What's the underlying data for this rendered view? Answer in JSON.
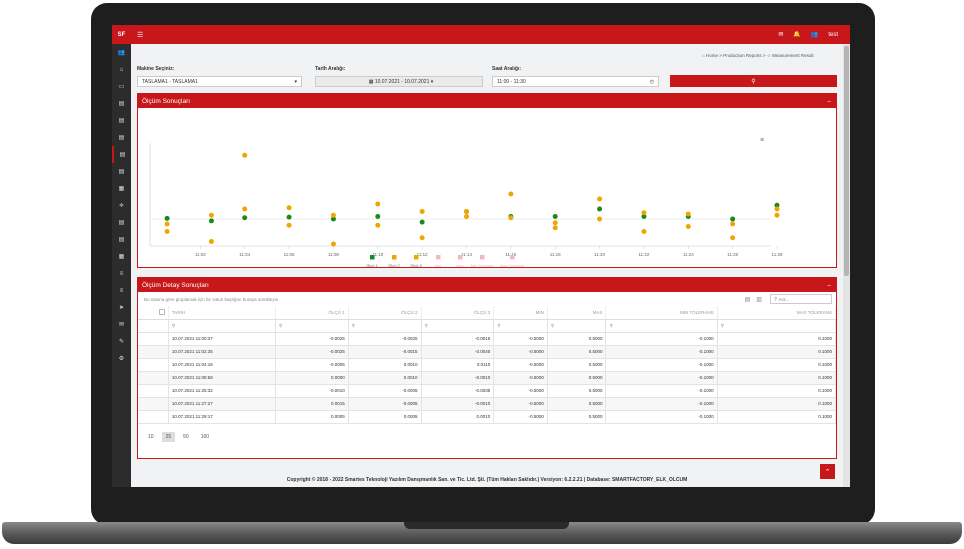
{
  "app": {
    "logo": "SF",
    "menu_icon": "hamburger-icon",
    "topbar_icons": [
      "chat-icon",
      "bell-icon",
      "users-icon"
    ],
    "username": "test"
  },
  "sidebar": {
    "icons": [
      "users-icon",
      "home-icon",
      "monitor-icon",
      "file-icon",
      "file-icon",
      "file-icon",
      "file-icon",
      "file-icon",
      "calendar-icon",
      "settings-icon",
      "file-icon",
      "file-icon",
      "calendar-icon",
      "list-icon",
      "list-icon",
      "send-icon",
      "chat-icon",
      "pen-icon",
      "gear-icon"
    ]
  },
  "breadcrumb": {
    "home": "Home",
    "reports": "Production Reports",
    "current": "Measurement Result"
  },
  "filters": {
    "machine_label": "Makine Seçiniz:",
    "machine_value": "TASLAMA1 - TASLAMA1",
    "date_label": "Tarih Aralığı:",
    "date_value": "10.07.2021 - 10.07.2021",
    "time_label": "Saat Aralığı:",
    "time_value": "11:00 - 11:30",
    "search_icon": "search-icon"
  },
  "chart_panel": {
    "title": "Ölçüm Sonuçları",
    "collapse": "–",
    "menu_icon": "menu-icon"
  },
  "chart_data": {
    "type": "scatter",
    "x_ticks": [
      "11:02",
      "11:04",
      "11:06",
      "11:08",
      "11:10",
      "11:12",
      "11:14",
      "11:16",
      "11:18",
      "11:20",
      "11:22",
      "11:24",
      "11:26",
      "11:28"
    ],
    "series": [
      {
        "name": "Ölçü 1",
        "color": "#1a8a1a",
        "points": [
          [
            0.5,
            0.05
          ],
          [
            2.5,
            -0.15
          ],
          [
            4.0,
            0.1
          ],
          [
            6.0,
            0.15
          ],
          [
            8.0,
            0.0
          ],
          [
            10.0,
            0.2
          ],
          [
            12.0,
            -0.25
          ],
          [
            14.0,
            0.6
          ],
          [
            16.0,
            0.2
          ],
          [
            18.0,
            0.2
          ],
          [
            20.0,
            0.8
          ],
          [
            22.0,
            0.2
          ],
          [
            24.0,
            0.2
          ],
          [
            26.0,
            0.0
          ],
          [
            28.0,
            1.1
          ]
        ]
      },
      {
        "name": "Ölçü 2",
        "color": "#f0a500",
        "points": [
          [
            0.5,
            -0.4
          ],
          [
            2.5,
            0.3
          ],
          [
            4.0,
            0.8
          ],
          [
            6.0,
            0.9
          ],
          [
            8.0,
            0.3
          ],
          [
            10.0,
            -0.5
          ],
          [
            12.0,
            0.6
          ],
          [
            14.0,
            0.2
          ],
          [
            16.0,
            0.1
          ],
          [
            18.0,
            -0.3
          ],
          [
            20.0,
            0.0
          ],
          [
            22.0,
            0.5
          ],
          [
            24.0,
            0.4
          ],
          [
            26.0,
            -0.4
          ],
          [
            28.0,
            0.8
          ]
        ]
      },
      {
        "name": "Ölçü 3",
        "color": "#f0a500",
        "points": [
          [
            0.5,
            -1.0
          ],
          [
            2.5,
            -1.8
          ],
          [
            4.0,
            5.1
          ],
          [
            6.0,
            -0.5
          ],
          [
            8.0,
            -2.0
          ],
          [
            10.0,
            1.2
          ],
          [
            12.0,
            -1.5
          ],
          [
            14.0,
            0.6
          ],
          [
            16.0,
            2.0
          ],
          [
            18.0,
            -0.7
          ],
          [
            20.0,
            1.6
          ],
          [
            22.0,
            -1.0
          ],
          [
            24.0,
            -0.6
          ],
          [
            26.0,
            -1.5
          ],
          [
            28.0,
            0.3
          ]
        ]
      }
    ],
    "legend": [
      "Ölçü 1",
      "Ölçü 2",
      "Ölçü 3",
      "Min",
      "Max",
      "Min Tolerans",
      "Max Tolerans"
    ],
    "legend_colors": [
      "#1a8a1a",
      "#f0a500",
      "#f0a500",
      "#f3b7c4",
      "#f3b7c4",
      "#f3b7c4",
      "#f3b7c4"
    ]
  },
  "table_panel": {
    "title": "Ölçüm Detay Sonuçları",
    "collapse": "–",
    "group_hint": "Bu sütuna göre gruplamak için bir sütun başlığını buraya sürükleyin",
    "search_placeholder": "Ara...",
    "columns": [
      "TARİH",
      "ÖLÇÜ 1",
      "ÖLÇÜ 2",
      "ÖLÇÜ 3",
      "MIN",
      "MAX",
      "MIN TOLERANS",
      "MAX TOLERANS"
    ],
    "rows": [
      [
        "10.07.2021 11:00:37",
        "-0.0025",
        "-0.0025",
        "-0.0015",
        "-0.5000",
        "0.5000",
        "-0.1000",
        "0.1000"
      ],
      [
        "10.07.2021 11:02:35",
        "-0.0025",
        "-0.0015",
        "-0.0040",
        "-0.5000",
        "0.5000",
        "-0.1000",
        "0.1000"
      ],
      [
        "10.07.2021 11:04:16",
        "-0.0005",
        "0.0010",
        "0.0110",
        "-0.5000",
        "0.5000",
        "-0.1000",
        "0.1000"
      ],
      [
        "10.07.2021 11:05:58",
        "0.0000",
        "0.0010",
        "-0.0010",
        "-0.5000",
        "0.5000",
        "-0.1000",
        "0.1000"
      ],
      [
        "10.07.2021 11:25:32",
        "-0.0010",
        "-0.0005",
        "-0.0035",
        "-0.5000",
        "0.5000",
        "-0.1000",
        "0.1000"
      ],
      [
        "10.07.2021 11:27:27",
        "0.0015",
        "-0.0005",
        "-0.0010",
        "-0.5000",
        "0.5000",
        "-0.1000",
        "0.1000"
      ],
      [
        "10.07.2021 11:29:17",
        "0.0005",
        "0.0005",
        "0.0010",
        "-0.5000",
        "0.5000",
        "-0.1000",
        "0.1000"
      ]
    ],
    "page_sizes": [
      "10",
      "25",
      "50",
      "100"
    ],
    "active_page_size": "25"
  },
  "footer": "Copyright © 2018 - 2022 Smartes Teknoloji Yazılım Danışmanlık San. ve Tic. Ltd. Şti. (Tüm Hakları Saklıdır.) Versiyon: 6.2.2.21 | Database: SMARTFACTORY_ELK_OLCUM"
}
